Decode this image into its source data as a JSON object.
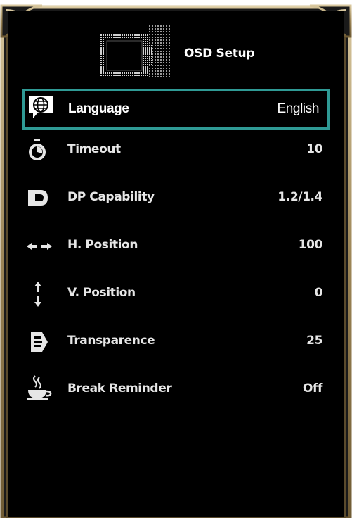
{
  "osd": {
    "title": "OSD Setup",
    "accent_color": "#2f9a95",
    "frame_color": "#b8a377",
    "items": [
      {
        "icon": "globe-speech-icon",
        "label": "Language",
        "value": "English",
        "selected": true
      },
      {
        "icon": "timer-icon",
        "label": "Timeout",
        "value": "10"
      },
      {
        "icon": "displayport-icon",
        "label": "DP Capability",
        "value": "1.2/1.4"
      },
      {
        "icon": "horizontal-arrows-icon",
        "label": "H. Position",
        "value": "100"
      },
      {
        "icon": "vertical-arrows-icon",
        "label": "V. Position",
        "value": "0"
      },
      {
        "icon": "transparence-icon",
        "label": "Transparence",
        "value": "25"
      },
      {
        "icon": "coffee-cup-icon",
        "label": "Break Reminder",
        "value": "Off"
      }
    ]
  }
}
